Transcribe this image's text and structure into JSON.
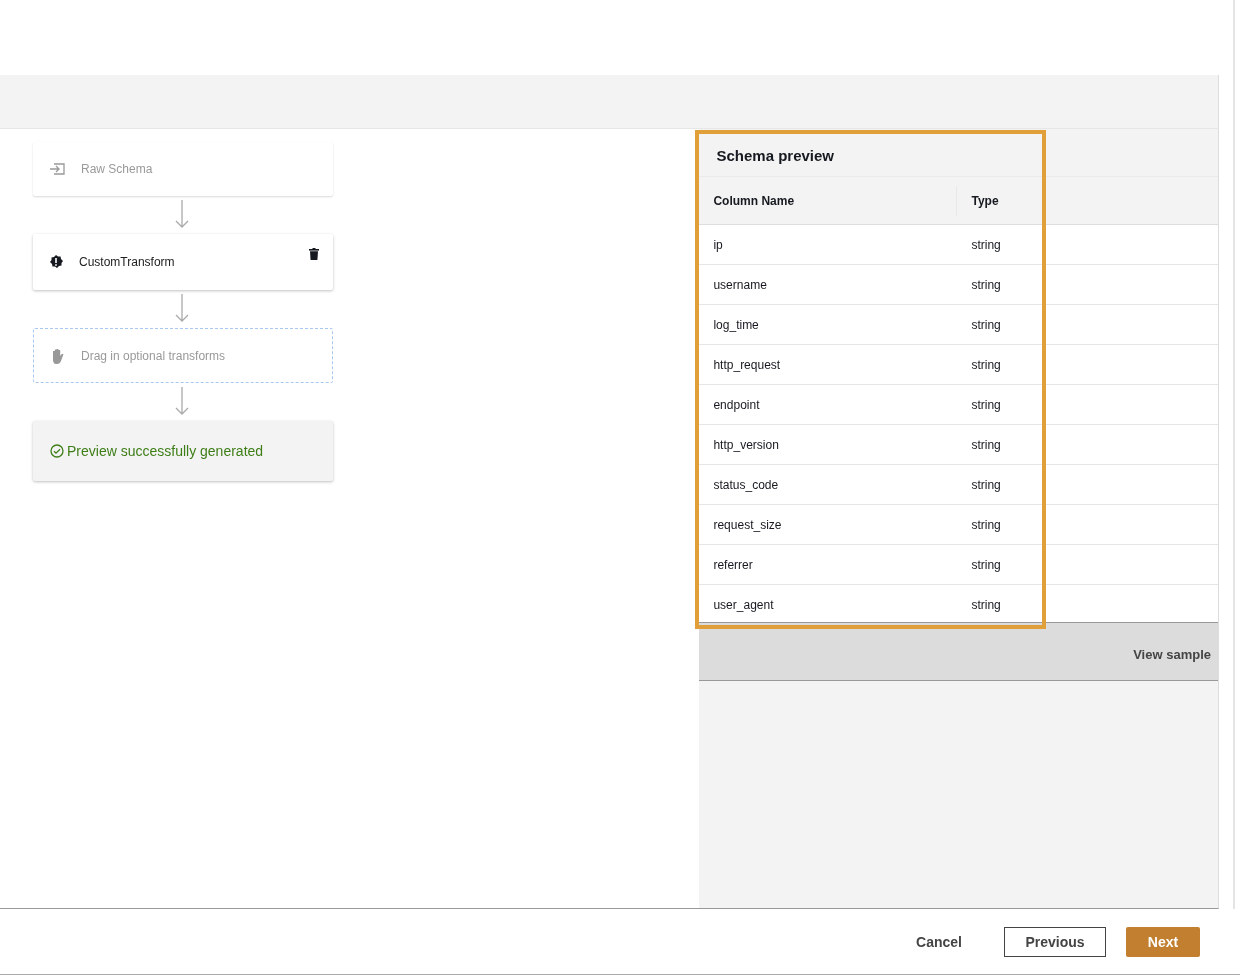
{
  "pipeline": {
    "steps": [
      {
        "kind": "source",
        "label": "Raw Schema"
      },
      {
        "kind": "transform",
        "label": "CustomTransform"
      },
      {
        "kind": "dropzone",
        "label": "Drag in optional transforms"
      },
      {
        "kind": "status",
        "label": "Preview successfully generated"
      }
    ]
  },
  "schema_preview": {
    "title": "Schema preview",
    "columns": [
      "Column Name",
      "Type"
    ],
    "rows": [
      [
        "ip",
        "string"
      ],
      [
        "username",
        "string"
      ],
      [
        "log_time",
        "string"
      ],
      [
        "http_request",
        "string"
      ],
      [
        "endpoint",
        "string"
      ],
      [
        "http_version",
        "string"
      ],
      [
        "status_code",
        "string"
      ],
      [
        "request_size",
        "string"
      ],
      [
        "referrer",
        "string"
      ],
      [
        "user_agent",
        "string"
      ]
    ],
    "view_sample": "View sample"
  },
  "footer": {
    "buttons": [
      {
        "kind": "link",
        "label": "Cancel"
      },
      {
        "kind": "secondary",
        "label": "Previous"
      },
      {
        "kind": "primary",
        "label": "Next"
      }
    ]
  }
}
